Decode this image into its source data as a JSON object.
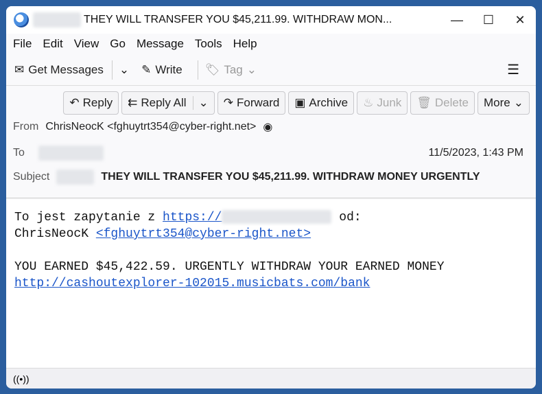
{
  "window": {
    "title": "THEY WILL TRANSFER YOU $45,211.99. WITHDRAW MON...",
    "minimize": "—",
    "maximize": "☐",
    "close": "✕"
  },
  "menu": [
    "File",
    "Edit",
    "View",
    "Go",
    "Message",
    "Tools",
    "Help"
  ],
  "toolbar": {
    "get_messages": "Get Messages",
    "write": "Write",
    "tag": "Tag"
  },
  "actions": {
    "reply": "Reply",
    "reply_all": "Reply All",
    "forward": "Forward",
    "archive": "Archive",
    "junk": "Junk",
    "delete": "Delete",
    "more": "More"
  },
  "header": {
    "from_label": "From",
    "from": "ChrisNeocK <fghuytrt354@cyber-right.net>",
    "to_label": "To",
    "date": "11/5/2023, 1:43 PM",
    "subject_label": "Subject",
    "subject": "THEY WILL TRANSFER YOU $45,211.99. WITHDRAW MONEY URGENTLY"
  },
  "body": {
    "line1_prefix": "To jest zapytanie z ",
    "line1_link": "https://",
    "line1_suffix": " od:",
    "line2_name": "ChrisNeocK ",
    "line2_link": "<fghuytrt354@cyber-right.net>",
    "line3": "YOU EARNED $45,422.59. URGENTLY WITHDRAW YOUR EARNED MONEY",
    "line4_link": "http://cashoutexplorer-102015.musicbats.com/bank"
  }
}
